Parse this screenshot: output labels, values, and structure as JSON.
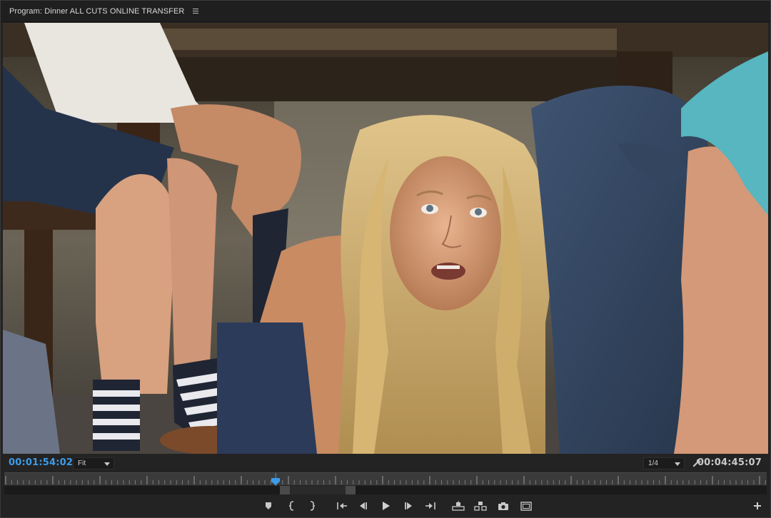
{
  "panel": {
    "title": "Program: Dinner ALL CUTS ONLINE TRANSFER",
    "menu_icon": "hamburger-menu-icon"
  },
  "viewer": {
    "current_timecode": "00:01:54:02",
    "duration_timecode": "00:04:45:07",
    "zoom_level": "Fit",
    "playback_resolution": "1/4",
    "playhead_fraction": 0.356
  },
  "transport": {
    "buttons": [
      {
        "name": "add-marker-button",
        "icon": "marker-icon"
      },
      {
        "name": "mark-in-button",
        "icon": "mark-in-icon",
        "glyph": "{"
      },
      {
        "name": "mark-out-button",
        "icon": "mark-out-icon",
        "glyph": "}"
      },
      {
        "name": "go-to-in-button",
        "icon": "go-to-in-icon"
      },
      {
        "name": "step-back-button",
        "icon": "step-back-icon"
      },
      {
        "name": "play-button",
        "icon": "play-icon"
      },
      {
        "name": "step-forward-button",
        "icon": "step-forward-icon"
      },
      {
        "name": "go-to-out-button",
        "icon": "go-to-out-icon"
      },
      {
        "name": "lift-button",
        "icon": "lift-icon"
      },
      {
        "name": "extract-button",
        "icon": "extract-icon"
      },
      {
        "name": "export-frame-button",
        "icon": "camera-icon"
      },
      {
        "name": "safe-margins-button",
        "icon": "safe-margins-icon"
      },
      {
        "name": "button-editor-button",
        "icon": "plus-icon"
      }
    ]
  },
  "colors": {
    "timecode_accent": "#3d9be9",
    "panel_bg": "#232323",
    "ruler_bg": "#3a3a3a"
  }
}
